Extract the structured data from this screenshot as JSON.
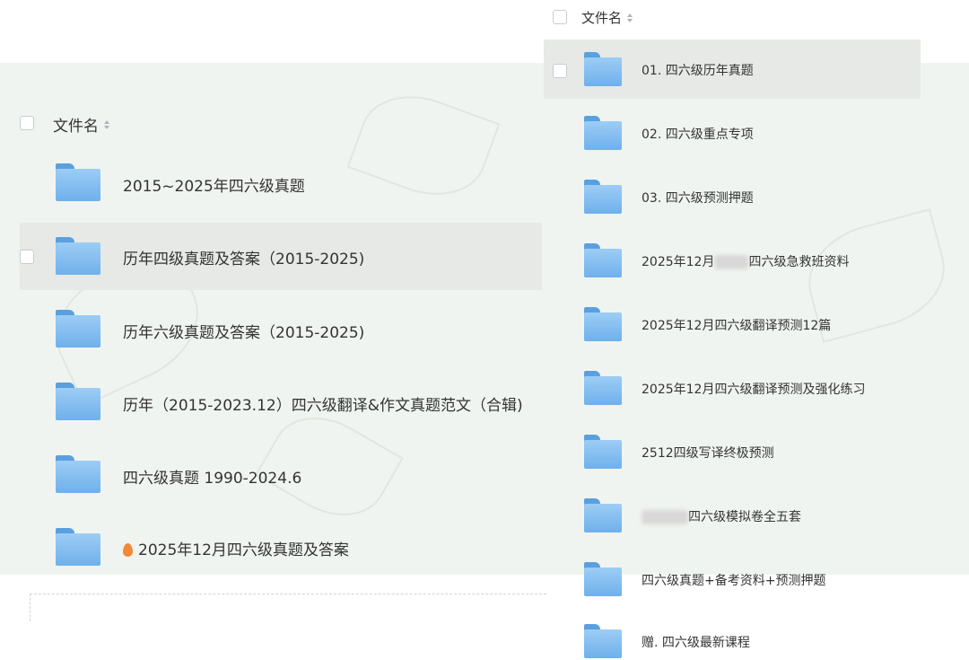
{
  "left": {
    "header": "文件名",
    "items": [
      {
        "label": "2015~2025年四六级真题"
      },
      {
        "label": "历年四级真题及答案（2015-2025)"
      },
      {
        "label": "历年六级真题及答案（2015-2025)"
      },
      {
        "label": "历年（2015-2023.12）四六级翻译&作文真题范文（合辑)"
      },
      {
        "label": "四六级真题 1990-2024.6"
      },
      {
        "label": "2025年12月四六级真题及答案"
      }
    ]
  },
  "right": {
    "header": "文件名",
    "items": [
      {
        "label": "01. 四六级历年真题"
      },
      {
        "label": "02. 四六级重点专项"
      },
      {
        "label": "03. 四六级预测押题"
      },
      {
        "pre": "2025年12月",
        "label": "四六级急救班资料"
      },
      {
        "label": "2025年12月四六级翻译预测12篇"
      },
      {
        "label": "2025年12月四六级翻译预测及强化练习"
      },
      {
        "label": "2512四级写译终极预测"
      },
      {
        "label": "四六级模拟卷全五套"
      },
      {
        "label": "四六级真题+备考资料+预测押题"
      },
      {
        "label": "赠. 四六级最新课程"
      }
    ]
  }
}
